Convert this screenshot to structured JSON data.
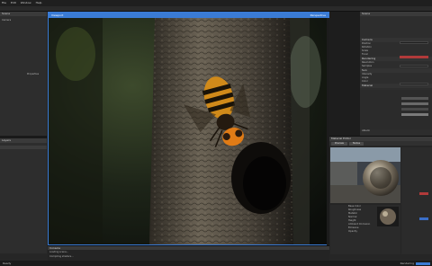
{
  "menubar": {
    "items": [
      "File",
      "Edit",
      "Window",
      "Help"
    ]
  },
  "top_left_panel": {
    "title": "Scene",
    "item": "Camera",
    "right_label": "Properties"
  },
  "bottom_left_panel": {
    "title": "Layers"
  },
  "viewport": {
    "header": "Viewport",
    "header_right": "Perspective",
    "accent": "#3a7bd5"
  },
  "right_panel": {
    "title": "Scene",
    "sections": [
      {
        "title": "Camera",
        "rows": [
          "Position",
          "Rotation",
          "Scale",
          "Focal"
        ]
      },
      {
        "title": "Rendering",
        "rows": [
          "Resolution",
          "Samples"
        ]
      },
      {
        "title": "Sun",
        "rows": [
          "Intensity",
          "Angle",
          "Color"
        ]
      },
      {
        "title": "Material",
        "rows": [
          "Albedo",
          "Roughness",
          "Metallic",
          "Normal",
          "Emission",
          "Opacity"
        ]
      }
    ]
  },
  "material_preview": {
    "title": "Material Editor",
    "tab_a": "Preview",
    "tab_b": "Nodes",
    "node_rows": [
      "Base Color",
      "Roughness",
      "Metallic",
      "Normal",
      "Height",
      "Ambient Occlusion",
      "Emissive",
      "Opacity"
    ]
  },
  "properties_strip": {
    "title": "Inspector"
  },
  "console": {
    "title": "Console",
    "lines": [
      "Loading scene...",
      "Compiling shaders...",
      "Ready"
    ]
  },
  "statusbar": {
    "left": "Ready",
    "right": "Rendering"
  }
}
